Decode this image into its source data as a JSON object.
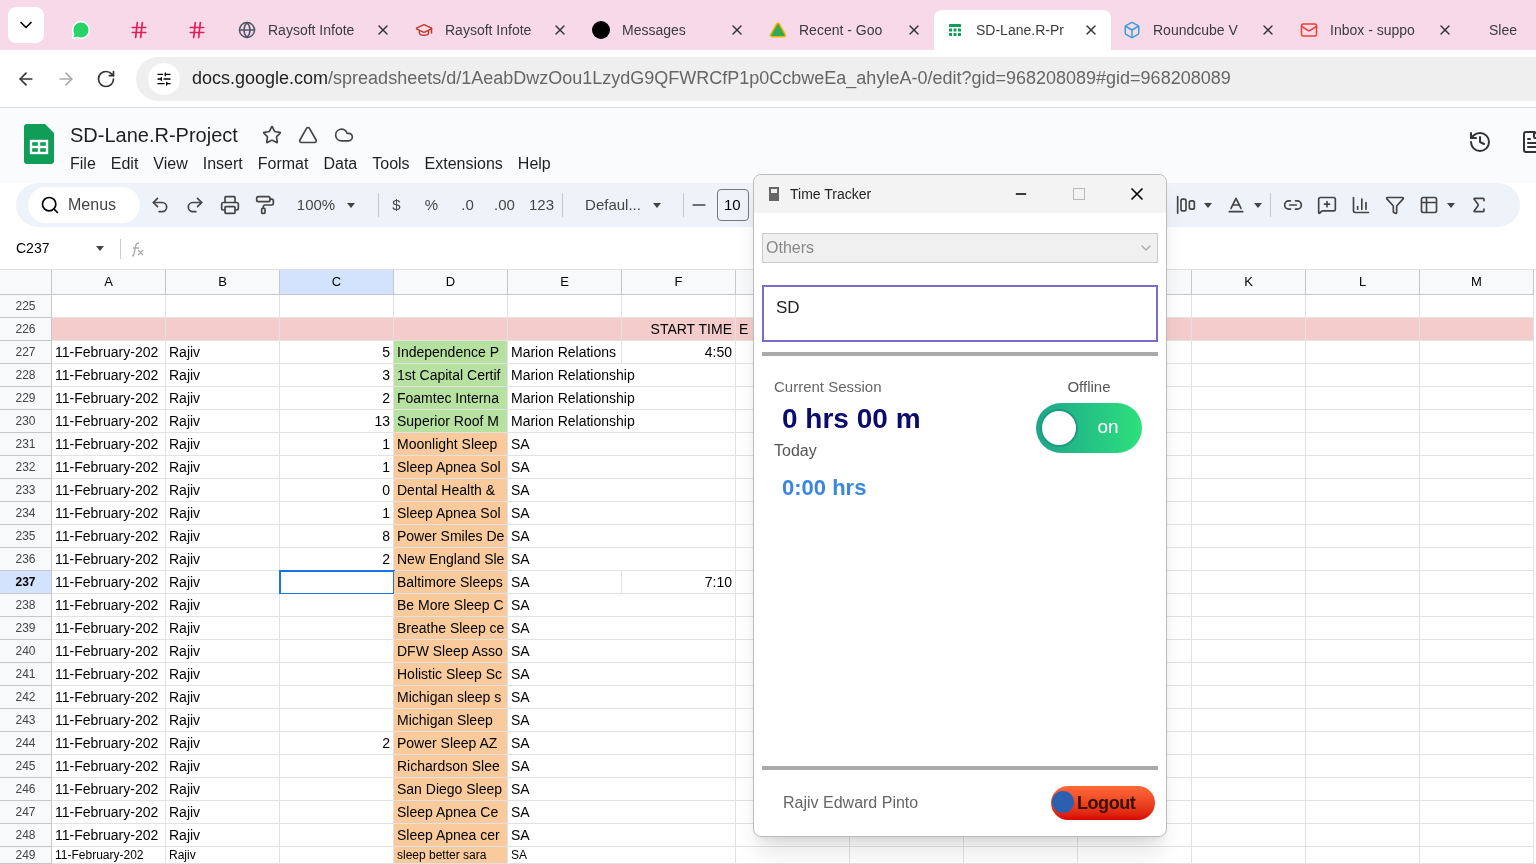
{
  "browser": {
    "tabs": [
      {
        "kind": "whatsapp",
        "selected": false
      },
      {
        "kind": "slack",
        "selected": false
      },
      {
        "kind": "slack",
        "selected": false
      },
      {
        "kind": "globe",
        "title": "Raysoft Infote",
        "selected": false
      },
      {
        "kind": "cap",
        "title": "Raysoft Infote",
        "selected": false
      },
      {
        "kind": "upwork",
        "title": "Messages",
        "selected": false
      },
      {
        "kind": "drive",
        "title": "Recent - Goo",
        "selected": false
      },
      {
        "kind": "sheets",
        "title": "SD-Lane.R-Pr",
        "selected": true
      },
      {
        "kind": "cube",
        "title": "Roundcube V",
        "selected": false
      },
      {
        "kind": "gmail",
        "title": "Inbox - suppo",
        "selected": false
      },
      {
        "kind": "phone",
        "title": "Slee",
        "selected": false
      }
    ],
    "url_host": "docs.google.com",
    "url_path": "/spreadsheets/d/1AeabDwzOou1LzydG9QFWRCfP1p0CcbweEa_ahyleA-0/edit?gid=968208089#gid=968208089"
  },
  "document": {
    "title": "SD-Lane.R-Project",
    "menu": [
      "File",
      "Edit",
      "View",
      "Insert",
      "Format",
      "Data",
      "Tools",
      "Extensions",
      "Help"
    ]
  },
  "toolbar": {
    "search": "Menus",
    "zoom": "100%",
    "currency": "$",
    "percent": "%",
    "decrease_decimals": ".0",
    "increase_decimals": ".00",
    "number_format": "123",
    "font": "Defaul...",
    "font_size": "10"
  },
  "formula_bar": {
    "cell_ref": "C237"
  },
  "sheet": {
    "columns": [
      {
        "label": "A",
        "selected": false
      },
      {
        "label": "B",
        "selected": false
      },
      {
        "label": "C",
        "selected": true
      },
      {
        "label": "D",
        "selected": false
      },
      {
        "label": "E",
        "selected": false
      },
      {
        "label": "F",
        "selected": false
      }
    ],
    "right_columns": [
      {
        "label": "K",
        "selected": false
      },
      {
        "label": "L",
        "selected": false
      },
      {
        "label": "M",
        "selected": false
      }
    ],
    "rows": [
      {
        "number": "225",
        "selected": false
      },
      {
        "number": "226",
        "selected": false,
        "color": "#f4cccc",
        "f": "START TIME",
        "g": "E"
      },
      {
        "number": "227",
        "selected": false,
        "a": "11-February-202",
        "b": "Rajiv",
        "c": "5",
        "d": {
          "text": "Independence P",
          "color": "#b7e1a1"
        },
        "e": "Marion Relations",
        "f": "4:50"
      },
      {
        "number": "228",
        "selected": false,
        "a": "11-February-202",
        "b": "Rajiv",
        "c": "3",
        "d": {
          "text": "1st Capital Certif",
          "color": "#b7e1a1"
        },
        "e": "Marion Relationship"
      },
      {
        "number": "229",
        "selected": false,
        "a": "11-February-202",
        "b": "Rajiv",
        "c": "2",
        "d": {
          "text": "Foamtec Interna",
          "color": "#b7e1a1"
        },
        "e": "Marion Relationship"
      },
      {
        "number": "230",
        "selected": false,
        "a": "11-February-202",
        "b": "Rajiv",
        "c": "13",
        "d": {
          "text": "Superior Roof M",
          "color": "#b7e1a1"
        },
        "e": "Marion Relationship"
      },
      {
        "number": "231",
        "selected": false,
        "a": "11-February-202",
        "b": "Rajiv",
        "c": "1",
        "d": {
          "text": "Moonlight Sleep",
          "color": "#f9cb9c"
        },
        "e": "SA"
      },
      {
        "number": "232",
        "selected": false,
        "a": "11-February-202",
        "b": "Rajiv",
        "c": "1",
        "d": {
          "text": "Sleep Apnea Sol",
          "color": "#f9cb9c"
        },
        "e": "SA"
      },
      {
        "number": "233",
        "selected": false,
        "a": "11-February-202",
        "b": "Rajiv",
        "c": "0",
        "d": {
          "text": "Dental Health &",
          "color": "#f9cb9c"
        },
        "e": "SA"
      },
      {
        "number": "234",
        "selected": false,
        "a": "11-February-202",
        "b": "Rajiv",
        "c": "1",
        "d": {
          "text": "Sleep Apnea Sol",
          "color": "#f9cb9c"
        },
        "e": "SA"
      },
      {
        "number": "235",
        "selected": false,
        "a": "11-February-202",
        "b": "Rajiv",
        "c": "8",
        "d": {
          "text": "Power Smiles De",
          "color": "#f9cb9c"
        },
        "e": "SA"
      },
      {
        "number": "236",
        "selected": false,
        "a": "11-February-202",
        "b": "Rajiv",
        "c": "2",
        "d": {
          "text": "New England Sle",
          "color": "#f9cb9c"
        },
        "e": "SA"
      },
      {
        "number": "237",
        "selected": true,
        "a": "11-February-202",
        "b": "Rajiv",
        "d": {
          "text": "Baltimore Sleeps",
          "color": "#f9cb9c"
        },
        "e": "SA",
        "f": "7:10"
      },
      {
        "number": "238",
        "selected": false,
        "a": "11-February-202",
        "b": "Rajiv",
        "d": {
          "text": "Be More Sleep C",
          "color": "#f9cb9c"
        },
        "e": "SA"
      },
      {
        "number": "239",
        "selected": false,
        "a": "11-February-202",
        "b": "Rajiv",
        "d": {
          "text": "Breathe Sleep ce",
          "color": "#f9cb9c"
        },
        "e": "SA"
      },
      {
        "number": "240",
        "selected": false,
        "a": "11-February-202",
        "b": "Rajiv",
        "d": {
          "text": "DFW Sleep Asso",
          "color": "#f9cb9c"
        },
        "e": "SA"
      },
      {
        "number": "241",
        "selected": false,
        "a": "11-February-202",
        "b": "Rajiv",
        "d": {
          "text": "Holistic Sleep Sc",
          "color": "#f9cb9c"
        },
        "e": "SA"
      },
      {
        "number": "242",
        "selected": false,
        "a": "11-February-202",
        "b": "Rajiv",
        "d": {
          "text": "Michigan sleep s",
          "color": "#f9cb9c"
        },
        "e": "SA"
      },
      {
        "number": "243",
        "selected": false,
        "a": "11-February-202",
        "b": "Rajiv",
        "d": {
          "text": "Michigan Sleep",
          "color": "#f9cb9c"
        },
        "e": "SA"
      },
      {
        "number": "244",
        "selected": false,
        "a": "11-February-202",
        "b": "Rajiv",
        "c": "2",
        "d": {
          "text": "Power Sleep AZ",
          "color": "#f9cb9c"
        },
        "e": "SA"
      },
      {
        "number": "245",
        "selected": false,
        "a": "11-February-202",
        "b": "Rajiv",
        "d": {
          "text": "Richardson Slee",
          "color": "#f9cb9c"
        },
        "e": "SA"
      },
      {
        "number": "246",
        "selected": false,
        "a": "11-February-202",
        "b": "Rajiv",
        "d": {
          "text": "San Diego Sleep",
          "color": "#f9cb9c"
        },
        "e": "SA"
      },
      {
        "number": "247",
        "selected": false,
        "a": "11-February-202",
        "b": "Rajiv",
        "d": {
          "text": "Sleep Apnea Ce",
          "color": "#f9cb9c"
        },
        "e": "SA"
      },
      {
        "number": "248",
        "selected": false,
        "a": "11-February-202",
        "b": "Rajiv",
        "d": {
          "text": "Sleep Apnea cer",
          "color": "#f9cb9c"
        },
        "e": "SA"
      },
      {
        "number": "249",
        "selected": false,
        "a": "11-February-202",
        "b": "Rajiv",
        "d": {
          "text": "sleep better sara",
          "color": "#f9cb9c"
        },
        "e": "SA"
      }
    ]
  },
  "time_tracker": {
    "title": "Time Tracker",
    "category": "Others",
    "task": "SD",
    "session_label": "Current Session",
    "session_value": "0 hrs 00 m",
    "status_label": "Offline",
    "toggle": {
      "on": true,
      "label": "on"
    },
    "today_label": "Today",
    "today_value": "0:00 hrs",
    "user": "Rajiv Edward Pinto",
    "logout": "Logout"
  }
}
